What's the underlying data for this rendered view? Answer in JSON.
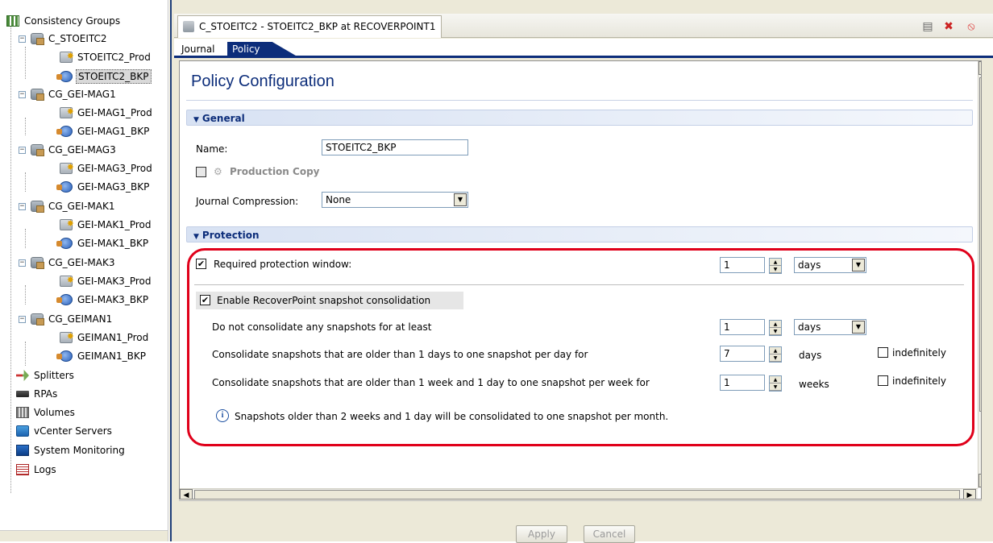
{
  "tree": {
    "root": "Consistency Groups",
    "groups": [
      {
        "name": "C_STOEITC2",
        "prod": "STOEITC2_Prod",
        "bkp": "STOEITC2_BKP"
      },
      {
        "name": "CG_GEI-MAG1",
        "prod": "GEI-MAG1_Prod",
        "bkp": "GEI-MAG1_BKP"
      },
      {
        "name": "CG_GEI-MAG3",
        "prod": "GEI-MAG3_Prod",
        "bkp": "GEI-MAG3_BKP"
      },
      {
        "name": "CG_GEI-MAK1",
        "prod": "GEI-MAK1_Prod",
        "bkp": "GEI-MAK1_BKP"
      },
      {
        "name": "CG_GEI-MAK3",
        "prod": "GEI-MAK3_Prod",
        "bkp": "GEI-MAK3_BKP"
      },
      {
        "name": "CG_GEIMAN1",
        "prod": "GEIMAN1_Prod",
        "bkp": "GEIMAN1_BKP"
      }
    ],
    "others": [
      "Splitters",
      "RPAs",
      "Volumes",
      "vCenter Servers",
      "System Monitoring",
      "Logs"
    ],
    "selected": "STOEITC2_BKP"
  },
  "window": {
    "title": "C_STOEITC2 - STOEITC2_BKP at RECOVERPOINT1",
    "tabs": [
      "Journal",
      "Policy"
    ],
    "active_tab": "Policy"
  },
  "policy": {
    "title": "Policy Configuration",
    "general": {
      "header": "General",
      "name_label": "Name:",
      "name_value": "STOEITC2_BKP",
      "production_copy_label": "Production Copy",
      "journal_compression_label": "Journal Compression:",
      "journal_compression_value": "None"
    },
    "protection": {
      "header": "Protection",
      "required_window_label": "Required protection window:",
      "required_window_value": "1",
      "required_window_unit": "days",
      "snapshot_consolidation_label": "Enable RecoverPoint snapshot consolidation",
      "no_consolidate_label": "Do not consolidate any snapshots for at least",
      "no_consolidate_value": "1",
      "no_consolidate_unit": "days",
      "daily_label": "Consolidate snapshots that are older than 1 days to one snapshot per day for",
      "daily_value": "7",
      "daily_unit": "days",
      "weekly_label": "Consolidate snapshots that are older than 1 week and 1 day to one snapshot per week for",
      "weekly_value": "1",
      "weekly_unit": "weeks",
      "indefinitely_label": "indefinitely",
      "info_text": "Snapshots older than 2 weeks and 1 day will be consolidated to one snapshot per month."
    },
    "checkbox_states": {
      "required_window": true,
      "snapshot_consolidation": true,
      "production_copy": false,
      "daily_indefinitely": false,
      "weekly_indefinitely": false
    }
  },
  "buttons": {
    "apply": "Apply",
    "cancel": "Cancel"
  },
  "colors": {
    "accent": "#0c2d7a",
    "highlight_outline": "#e0001a"
  }
}
